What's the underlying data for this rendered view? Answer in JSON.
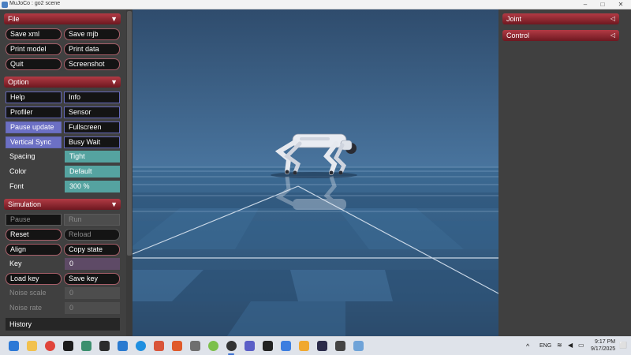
{
  "window": {
    "title": "MuJoCo : go2 scene"
  },
  "left_panel": {
    "file": {
      "header": "File",
      "buttons": [
        "Save xml",
        "Save mjb",
        "Print model",
        "Print data",
        "Quit",
        "Screenshot"
      ]
    },
    "option": {
      "header": "Option",
      "checkboxes": [
        {
          "label": "Help",
          "checked": false
        },
        {
          "label": "Info",
          "checked": false
        },
        {
          "label": "Profiler",
          "checked": false
        },
        {
          "label": "Sensor",
          "checked": false
        },
        {
          "label": "Pause update",
          "checked": true
        },
        {
          "label": "Fullscreen",
          "checked": false
        },
        {
          "label": "Vertical Sync",
          "checked": true
        },
        {
          "label": "Busy Wait",
          "checked": false
        }
      ],
      "spacing_label": "Spacing",
      "spacing_value": "Tight",
      "color_label": "Color",
      "color_value": "Default",
      "font_label": "Font",
      "font_value": "300 %"
    },
    "simulation": {
      "header": "Simulation",
      "pause_label": "Pause",
      "run_label": "Run",
      "reset_label": "Reset",
      "reload_label": "Reload",
      "align_label": "Align",
      "copy_state_label": "Copy state",
      "key_label": "Key",
      "key_value": "0",
      "load_key_label": "Load key",
      "save_key_label": "Save key",
      "noise_scale_label": "Noise scale",
      "noise_scale_value": "0",
      "noise_rate_label": "Noise rate",
      "noise_rate_value": "0",
      "history_label": "History"
    }
  },
  "right_panel": {
    "joint_header": "Joint",
    "control_header": "Control"
  },
  "taskbar": {
    "language": "ENG",
    "time": "9:17 PM",
    "date": "9/17/2025",
    "icons": [
      "windows-start-icon",
      "file-explorer-icon",
      "chrome-icon",
      "pycharm-icon",
      "app-icon",
      "terminal-icon",
      "vscode-icon",
      "docker-icon",
      "git-icon",
      "app-icon",
      "tools-icon",
      "android-icon",
      "mujoco-icon",
      "teams-icon",
      "app-icon",
      "security-icon",
      "calendar-icon",
      "app-icon",
      "app-icon",
      "app-icon"
    ]
  },
  "colors": {
    "accent": "#a82e39",
    "checkbox_on": "#6c70c4",
    "select": "#55a3a0",
    "field": "#5e4a66",
    "panel_bg": "#404040",
    "sky": "#355a80"
  }
}
